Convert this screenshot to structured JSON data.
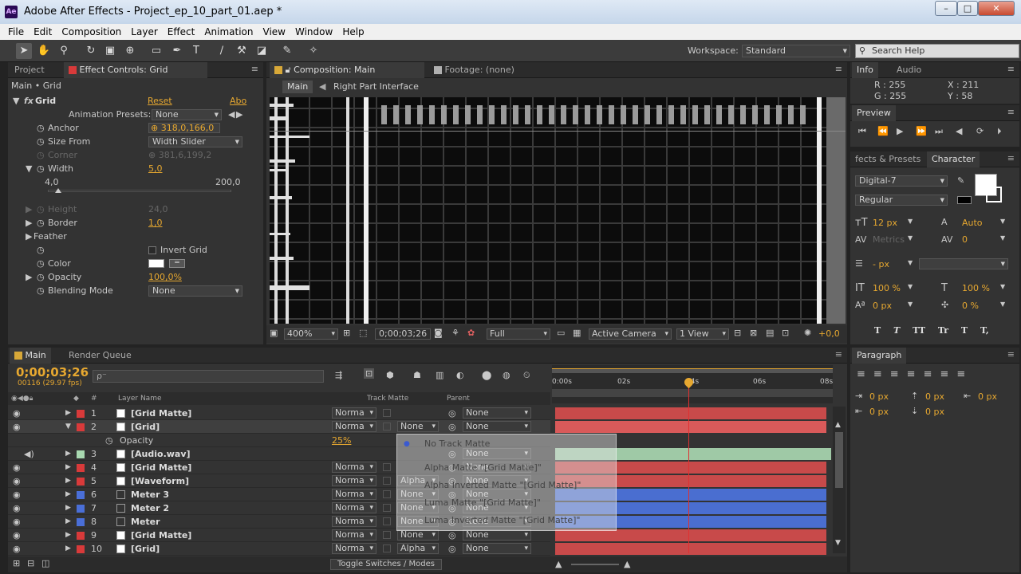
{
  "app": {
    "icon": "Ae",
    "title": "Adobe After Effects - Project_ep_10_part_01.aep *"
  },
  "window_controls": {
    "minimize": "–",
    "maximize": "□",
    "close": "✕"
  },
  "menu": [
    "File",
    "Edit",
    "Composition",
    "Layer",
    "Effect",
    "Animation",
    "View",
    "Window",
    "Help"
  ],
  "workspace": {
    "label": "Workspace:",
    "value": "Standard"
  },
  "search_help": "Search Help",
  "left_panel": {
    "tabs": [
      "Project",
      "Effect Controls: Grid"
    ],
    "breadcrumb": "Main • Grid",
    "effect_name": "Grid",
    "reset": "Reset",
    "about": "Abo",
    "animation_presets_label": "Animation Presets:",
    "animation_presets_value": "None",
    "props": {
      "anchor": {
        "label": "Anchor",
        "value": "318,0,166,0"
      },
      "size_from": {
        "label": "Size From",
        "value": "Width Slider"
      },
      "corner": {
        "label": "Corner",
        "value": "381,6,199,2"
      },
      "width": {
        "label": "Width",
        "value": "5,0",
        "min": "4,0",
        "max": "200,0",
        "slider_fraction": 0.0
      },
      "height": {
        "label": "Height",
        "value": "24,0"
      },
      "border": {
        "label": "Border",
        "value": "1,0"
      },
      "feather": {
        "label": "Feather"
      },
      "invert": {
        "label": "Invert Grid"
      },
      "color": {
        "label": "Color"
      },
      "opacity": {
        "label": "Opacity",
        "value": "100,0%"
      },
      "blending": {
        "label": "Blending Mode",
        "value": "None"
      }
    }
  },
  "comp_panel": {
    "tab": "Composition: Main",
    "footage_tab": "Footage: (none)",
    "flow": [
      "Main",
      "Right Part Interface"
    ],
    "zoom": "400%",
    "timecode": "0;00;03;26",
    "resolution": "Full",
    "camera": "Active Camera",
    "views": "1 View",
    "exposure": "+0,0"
  },
  "info_panel": {
    "tabs": [
      "Info",
      "Audio"
    ],
    "r": "R : 255",
    "g": "G : 255",
    "x": "X : 211",
    "y": "Y : 58"
  },
  "preview_panel": {
    "tab": "Preview"
  },
  "char_panel": {
    "tabs": [
      "fects & Presets",
      "Character"
    ],
    "font": "Digital-7",
    "style": "Regular",
    "size": "12 px",
    "leading": "Auto",
    "kerning": "Metrics",
    "tracking": "0",
    "stroke": "- px",
    "vscale": "100 %",
    "hscale": "100 %",
    "baseline": "0 px",
    "tsume": "0 %",
    "styles": [
      "T",
      "T",
      "TT",
      "Tr",
      "T",
      "T,"
    ]
  },
  "paragraph_panel": {
    "tab": "Paragraph",
    "indents": [
      "0 px",
      "0 px",
      "0 px",
      "0 px",
      "0 px"
    ]
  },
  "timeline": {
    "tabs": [
      "Main",
      "Render Queue"
    ],
    "timecode": "0;00;03;26",
    "frame_info": "00116 (29.97 fps)",
    "search_placeholder": "ρ⁻",
    "columns": {
      "num": "#",
      "name": "Layer Name",
      "trackmatte": "Track Matte",
      "parent": "Parent"
    },
    "ruler": [
      "0:00s",
      "02s",
      "04s",
      "06s",
      "08s"
    ],
    "playhead_fraction": 0.487,
    "layers": [
      {
        "num": "1",
        "name": "[Grid Matte]",
        "mode": "Norma",
        "tm": "",
        "parent": "None",
        "color": "#d83a3a",
        "bar": "#c84a4a",
        "bracket": true
      },
      {
        "num": "2",
        "name": "[Grid]",
        "mode": "Norma",
        "tm": "None",
        "parent": "None",
        "color": "#d83a3a",
        "bar": "#d95a5a",
        "bracket": true,
        "selected": true
      },
      {
        "num": "3",
        "name": "[Audio.wav]",
        "mode": "",
        "tm": "",
        "parent": "None",
        "color": "#a8d8b0",
        "bar": "#9fc9a6",
        "bracket": true
      },
      {
        "num": "4",
        "name": "[Grid Matte]",
        "mode": "Norma",
        "tm": "",
        "parent": "None",
        "color": "#d83a3a",
        "bar": "#c84a4a",
        "bracket": true
      },
      {
        "num": "5",
        "name": "[Waveform]",
        "mode": "Norma",
        "tm": "Alpha",
        "parent": "None",
        "color": "#d83a3a",
        "bar": "#c84a4a",
        "bracket": true
      },
      {
        "num": "6",
        "name": "Meter 3",
        "mode": "Norma",
        "tm": "None",
        "parent": "None",
        "color": "#4a6fd8",
        "bar": "#4a6ed0",
        "bracket": false
      },
      {
        "num": "7",
        "name": "Meter 2",
        "mode": "Norma",
        "tm": "None",
        "parent": "None",
        "color": "#4a6fd8",
        "bar": "#4a6ed0",
        "bracket": false
      },
      {
        "num": "8",
        "name": "Meter",
        "mode": "Norma",
        "tm": "None",
        "parent": "None",
        "color": "#4a6fd8",
        "bar": "#4a6ed0",
        "bracket": false
      },
      {
        "num": "9",
        "name": "[Grid Matte]",
        "mode": "Norma",
        "tm": "None",
        "parent": "None",
        "color": "#d83a3a",
        "bar": "#c84a4a",
        "bracket": true
      },
      {
        "num": "10",
        "name": "[Grid]",
        "mode": "Norma",
        "tm": "Alpha",
        "parent": "None",
        "color": "#d83a3a",
        "bar": "#c84a4a",
        "bracket": true
      }
    ],
    "opacity_row": {
      "label": "Opacity",
      "value": "25%"
    },
    "toggle": "Toggle Switches / Modes"
  },
  "matte_menu": [
    "No Track Matte",
    "Alpha Matte \"[Grid Matte]\"",
    "Alpha Inverted Matte \"[Grid Matte]\"",
    "Luma Matte \"[Grid Matte]\"",
    "Luma Inverted Matte \"[Grid Matte]\""
  ]
}
